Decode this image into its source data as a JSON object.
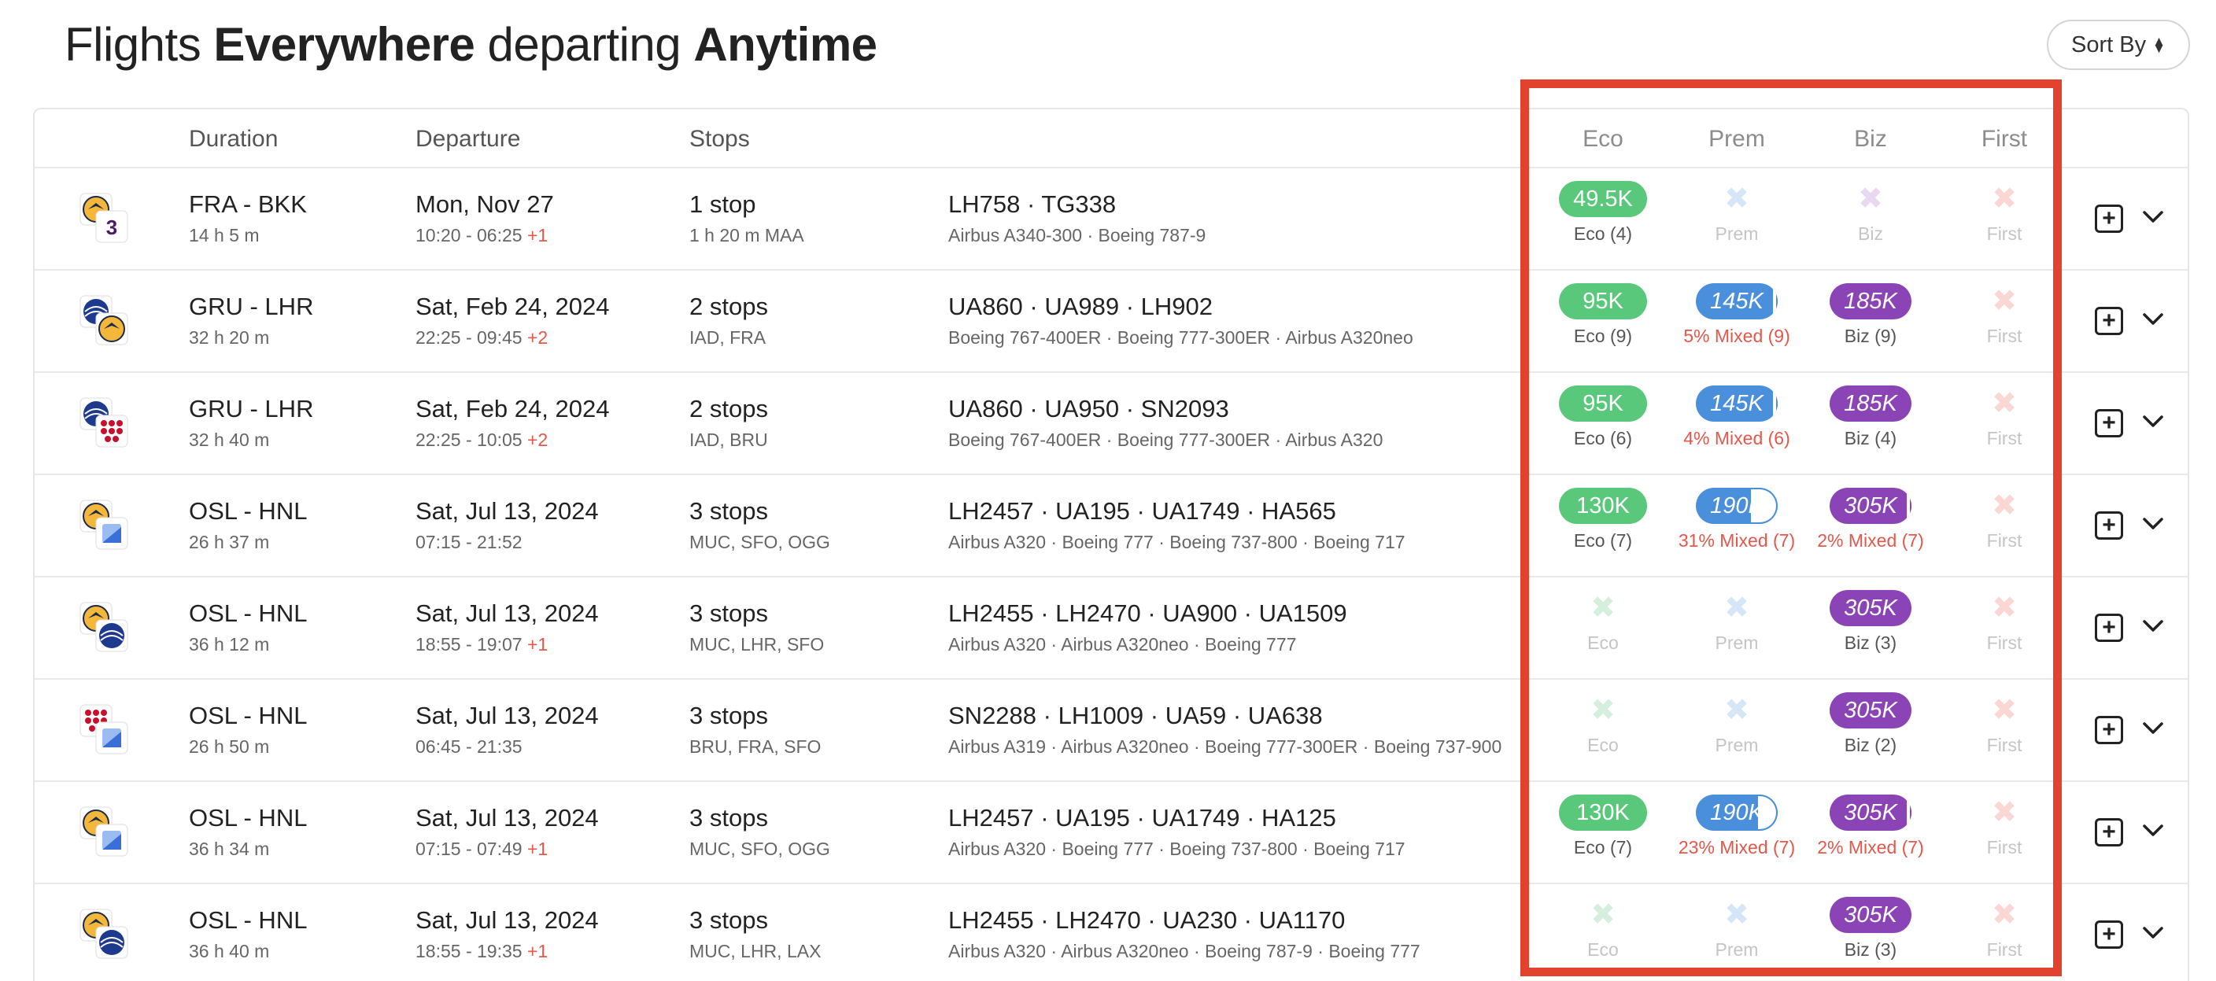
{
  "title": {
    "part1": "Flights ",
    "bold1": "Everywhere",
    "part2": " departing ",
    "bold2": "Anytime"
  },
  "sort_button": {
    "label": "Sort By"
  },
  "columns": {
    "duration": "Duration",
    "departure": "Departure",
    "stops": "Stops",
    "eco": "Eco",
    "prem": "Prem",
    "biz": "Biz",
    "first": "First"
  },
  "colors": {
    "eco": "#5ac87a",
    "prem": "#4a8fdc",
    "biz": "#8a44b6",
    "highlight": "#e2432f",
    "overnight": "#e4574a"
  },
  "rows": [
    {
      "airline_icons": [
        "lufthansa-logo-icon",
        "thai-logo-icon"
      ],
      "route": "FRA - BKK",
      "duration": "14 h 5 m",
      "date": "Mon, Nov 27",
      "times": "10:20 - 06:25",
      "plus": "+1",
      "stops": "1 stop",
      "via": "1 h 20 m  MAA",
      "flights": "LH758  ·  TG338",
      "aircraft": "Airbus A340-300  ·  Boeing 787-9",
      "eco": {
        "price": "49.5K",
        "label": "Eco (4)"
      },
      "prem": {
        "label": "Prem"
      },
      "biz": {
        "label": "Biz"
      },
      "first": {
        "label": "First"
      }
    },
    {
      "airline_icons": [
        "united-logo-icon",
        "lufthansa-logo-icon"
      ],
      "route": "GRU - LHR",
      "duration": "32 h 20 m",
      "date": "Sat, Feb 24, 2024",
      "times": "22:25 - 09:45",
      "plus": "+2",
      "stops": "2 stops",
      "via": "IAD, FRA",
      "flights": "UA860  ·  UA989  ·  LH902",
      "aircraft": "Boeing 767-400ER  ·  Boeing 777-300ER  ·  Airbus A320neo",
      "eco": {
        "price": "95K",
        "label": "Eco (9)"
      },
      "prem": {
        "price": "145K",
        "label": "5% Mixed (9)",
        "mixed": true,
        "fill": 0.95
      },
      "biz": {
        "price": "185K",
        "label": "Biz (9)"
      },
      "first": {
        "label": "First"
      }
    },
    {
      "airline_icons": [
        "united-logo-icon",
        "brussels-logo-icon"
      ],
      "route": "GRU - LHR",
      "duration": "32 h 40 m",
      "date": "Sat, Feb 24, 2024",
      "times": "22:25 - 10:05",
      "plus": "+2",
      "stops": "2 stops",
      "via": "IAD, BRU",
      "flights": "UA860  ·  UA950  ·  SN2093",
      "aircraft": "Boeing 767-400ER  ·  Boeing 777-300ER  ·  Airbus A320",
      "eco": {
        "price": "95K",
        "label": "Eco (6)"
      },
      "prem": {
        "price": "145K",
        "label": "4% Mixed (6)",
        "mixed": true,
        "fill": 0.96
      },
      "biz": {
        "price": "185K",
        "label": "Biz (4)"
      },
      "first": {
        "label": "First"
      }
    },
    {
      "airline_icons": [
        "lufthansa-logo-icon",
        "hawaiian-logo-icon"
      ],
      "route": "OSL - HNL",
      "duration": "26 h 37 m",
      "date": "Sat, Jul 13, 2024",
      "times": "07:15 - 21:52",
      "plus": "",
      "stops": "3 stops",
      "via": "MUC, SFO, OGG",
      "flights": "LH2457  ·  UA195  ·  UA1749  ·  HA565",
      "aircraft": "Airbus A320  ·  Boeing 777  ·  Boeing 737-800  ·  Boeing 717",
      "eco": {
        "price": "130K",
        "label": "Eco (7)"
      },
      "prem": {
        "price": "190K",
        "label": "31% Mixed (7)",
        "mixed": true,
        "fill": 0.69
      },
      "biz": {
        "price": "305K",
        "label": "2% Mixed (7)",
        "mixed": true,
        "fill": 0.98
      },
      "first": {
        "label": "First"
      }
    },
    {
      "airline_icons": [
        "lufthansa-logo-icon",
        "united-logo-icon"
      ],
      "route": "OSL - HNL",
      "duration": "36 h 12 m",
      "date": "Sat, Jul 13, 2024",
      "times": "18:55 - 19:07",
      "plus": "+1",
      "stops": "3 stops",
      "via": "MUC, LHR, SFO",
      "flights": "LH2455  ·  LH2470  ·  UA900  ·  UA1509",
      "aircraft": "Airbus A320  ·  Airbus A320neo  ·  Boeing 777",
      "eco": {
        "label": "Eco"
      },
      "prem": {
        "label": "Prem"
      },
      "biz": {
        "price": "305K",
        "label": "Biz (3)"
      },
      "first": {
        "label": "First"
      }
    },
    {
      "airline_icons": [
        "brussels-logo-icon",
        "hawaiian-logo-icon"
      ],
      "route": "OSL - HNL",
      "duration": "26 h 50 m",
      "date": "Sat, Jul 13, 2024",
      "times": "06:45 - 21:35",
      "plus": "",
      "stops": "3 stops",
      "via": "BRU, FRA, SFO",
      "flights": "SN2288  ·  LH1009  ·  UA59  ·  UA638",
      "aircraft": "Airbus A319  ·  Airbus A320neo  ·  Boeing 777-300ER  ·  Boeing 737-900",
      "eco": {
        "label": "Eco"
      },
      "prem": {
        "label": "Prem"
      },
      "biz": {
        "price": "305K",
        "label": "Biz (2)"
      },
      "first": {
        "label": "First"
      }
    },
    {
      "airline_icons": [
        "lufthansa-logo-icon",
        "hawaiian-logo-icon"
      ],
      "route": "OSL - HNL",
      "duration": "36 h 34 m",
      "date": "Sat, Jul 13, 2024",
      "times": "07:15 - 07:49",
      "plus": "+1",
      "stops": "3 stops",
      "via": "MUC, SFO, OGG",
      "flights": "LH2457  ·  UA195  ·  UA1749  ·  HA125",
      "aircraft": "Airbus A320  ·  Boeing 777  ·  Boeing 737-800  ·  Boeing 717",
      "eco": {
        "price": "130K",
        "label": "Eco (7)"
      },
      "prem": {
        "price": "190K",
        "label": "23% Mixed (7)",
        "mixed": true,
        "fill": 0.77
      },
      "biz": {
        "price": "305K",
        "label": "2% Mixed (7)",
        "mixed": true,
        "fill": 0.98
      },
      "first": {
        "label": "First"
      }
    },
    {
      "airline_icons": [
        "lufthansa-logo-icon",
        "united-logo-icon"
      ],
      "route": "OSL - HNL",
      "duration": "36 h 40 m",
      "date": "Sat, Jul 13, 2024",
      "times": "18:55 - 19:35",
      "plus": "+1",
      "stops": "3 stops",
      "via": "MUC, LHR, LAX",
      "flights": "LH2455  ·  LH2470  ·  UA230  ·  UA1170",
      "aircraft": "Airbus A320  ·  Airbus A320neo  ·  Boeing 787-9  ·  Boeing 777",
      "eco": {
        "label": "Eco"
      },
      "prem": {
        "label": "Prem"
      },
      "biz": {
        "price": "305K",
        "label": "Biz (3)"
      },
      "first": {
        "label": "First"
      }
    }
  ]
}
